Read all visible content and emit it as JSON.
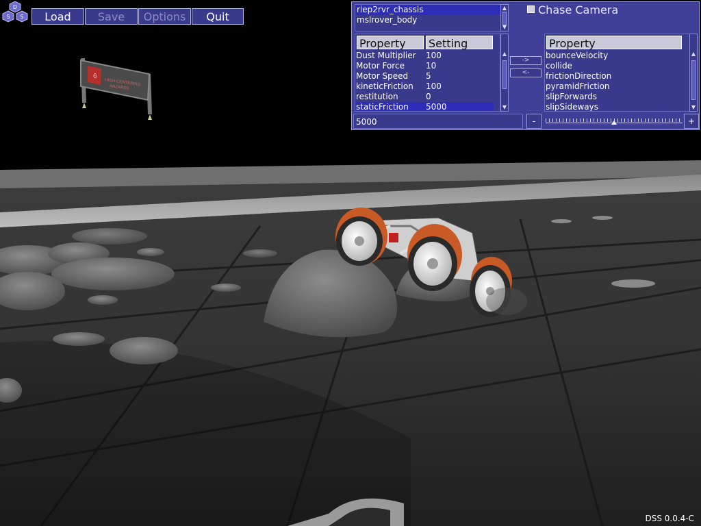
{
  "menu": {
    "load": "Load",
    "save": "Save",
    "options": "Options",
    "quit": "Quit"
  },
  "logo_letters": [
    "D",
    "S",
    "S"
  ],
  "panel": {
    "objects": [
      "rlep2rvr_chassis",
      "mslrover_body"
    ],
    "selected_object_index": 0,
    "chase_camera_label": "Chase Camera",
    "chase_camera_checked": false,
    "left_table": {
      "headers": [
        "Property",
        "Setting"
      ],
      "rows": [
        {
          "property": "Dust Multiplier",
          "setting": "100"
        },
        {
          "property": "Motor Force",
          "setting": "10"
        },
        {
          "property": "Motor Speed",
          "setting": "5"
        },
        {
          "property": "kineticFriction",
          "setting": "100"
        },
        {
          "property": "restitution",
          "setting": "0"
        },
        {
          "property": "staticFriction",
          "setting": "5000"
        }
      ],
      "selected_row": 5
    },
    "move_right_label": "->",
    "move_left_label": "<-",
    "right_table": {
      "header": "Property",
      "rows": [
        "bounceVelocity",
        "collide",
        "frictionDirection",
        "pyramidFriction",
        "slipForwards",
        "slipSideways"
      ]
    },
    "value_field": "5000",
    "minus_label": "-",
    "plus_label": "+",
    "slider_fraction": 0.5
  },
  "sign": {
    "text": "HIGH-CENTERING HAZARDS",
    "number": "6"
  },
  "version": "DSS 0.0.4-C",
  "colors": {
    "panel_bg": "#3f3f97",
    "selection": "#2d2db7",
    "wheel_orange": "#c85a25"
  }
}
